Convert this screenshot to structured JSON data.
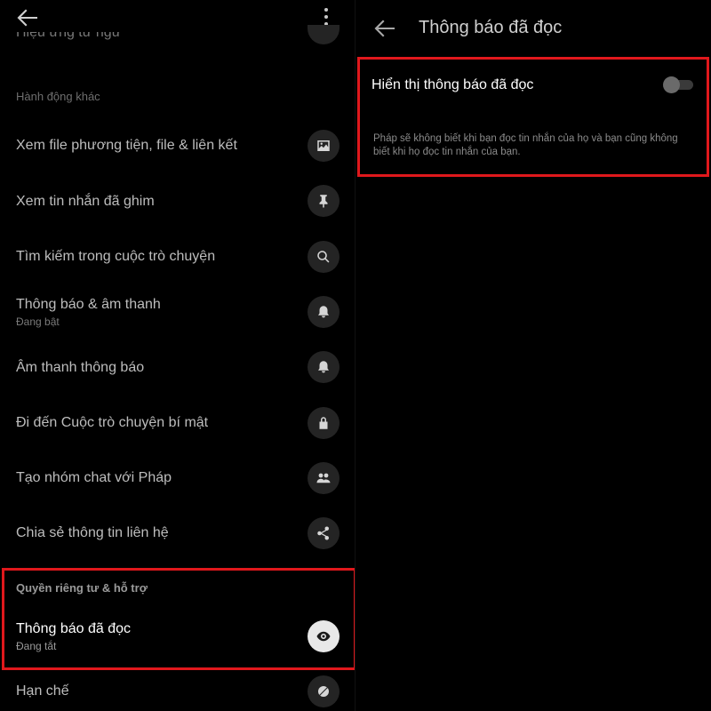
{
  "left": {
    "cut_row_label": "Hiệu ứng từ ngữ",
    "section_other": "Hành động khác",
    "items": [
      {
        "label": "Xem file phương tiện, file & liên kết",
        "sub": "",
        "icon": "image-icon"
      },
      {
        "label": "Xem tin nhắn đã ghim",
        "sub": "",
        "icon": "pin-icon"
      },
      {
        "label": "Tìm kiếm trong cuộc trò chuyện",
        "sub": "",
        "icon": "search-icon"
      },
      {
        "label": "Thông báo & âm thanh",
        "sub": "Đang bật",
        "icon": "bell-icon"
      },
      {
        "label": "Âm thanh thông báo",
        "sub": "",
        "icon": "bell-icon"
      },
      {
        "label": "Đi đến Cuộc trò chuyện bí mật",
        "sub": "",
        "icon": "lock-icon"
      },
      {
        "label": "Tạo nhóm chat với Pháp",
        "sub": "",
        "icon": "people-icon"
      },
      {
        "label": "Chia sẻ thông tin liên hệ",
        "sub": "",
        "icon": "share-icon"
      }
    ],
    "section_privacy": "Quyền riêng tư & hỗ trợ",
    "read_receipts": {
      "label": "Thông báo đã đọc",
      "sub": "Đang tắt",
      "icon": "eye-icon"
    },
    "restrict": {
      "label": "Hạn chế",
      "icon": "restrict-icon"
    }
  },
  "right": {
    "title": "Thông báo đã đọc",
    "setting_label": "Hiển thị thông báo đã đọc",
    "toggle_state": "off",
    "description": "Pháp sẽ không biết khi bạn đọc tin nhắn của họ và bạn cũng không biết khi họ đọc tin nhắn của bạn."
  },
  "colors": {
    "background": "#000000",
    "highlight": "#e0181c",
    "icon_bg": "#242424"
  }
}
